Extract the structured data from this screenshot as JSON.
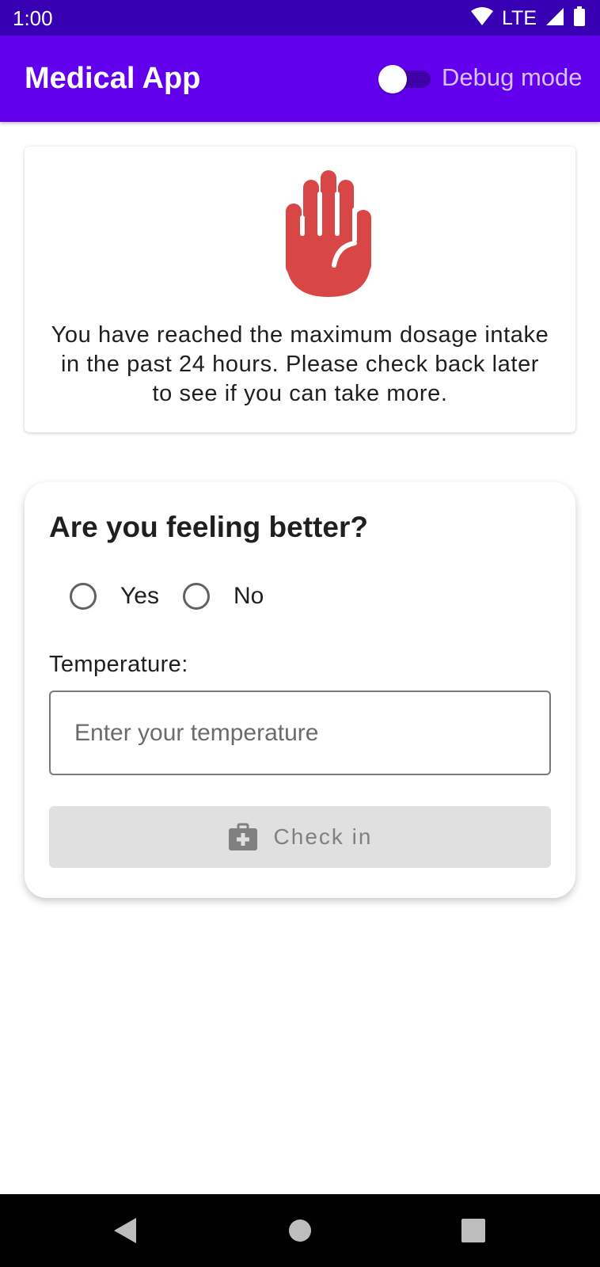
{
  "status_bar": {
    "time": "1:00",
    "network": "LTE",
    "icons": [
      "wifi-icon",
      "signal-icon",
      "battery-icon"
    ]
  },
  "app_bar": {
    "title": "Medical App",
    "debug_toggle": {
      "label": "Debug mode",
      "checked": false
    }
  },
  "alert_card": {
    "icon": "stop-hand-icon",
    "message": "You have reached the maximum dosage intake in the past 24 hours. Please check back later to see if you can take more."
  },
  "form": {
    "question": "Are you feeling better?",
    "options": [
      {
        "label": "Yes",
        "selected": false
      },
      {
        "label": "No",
        "selected": false
      }
    ],
    "temperature_label": "Temperature:",
    "temperature_value": "",
    "temperature_placeholder": "Enter your temperature",
    "checkin_button": {
      "label": "Check in",
      "icon": "medical-briefcase-icon",
      "enabled": false
    }
  },
  "nav_bar": {
    "buttons": [
      "back-icon",
      "home-icon",
      "recents-icon"
    ]
  },
  "colors": {
    "status_bar": "#3700b3",
    "app_bar": "#6200ee",
    "hand_icon": "#d84646",
    "button_disabled_bg": "#e0e0e0",
    "button_disabled_text": "#808080"
  }
}
